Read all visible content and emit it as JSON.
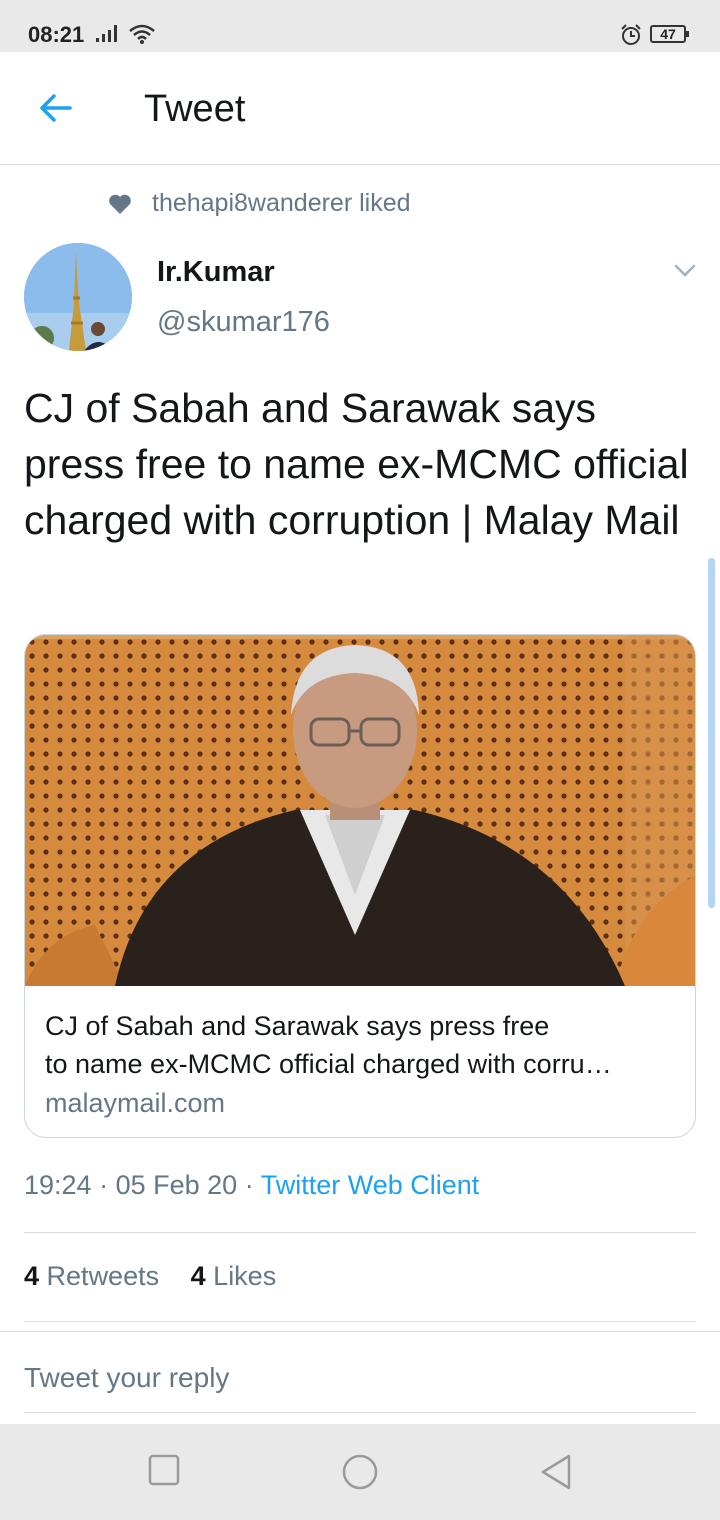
{
  "status": {
    "time": "08:21",
    "battery": "47"
  },
  "header": {
    "title": "Tweet"
  },
  "social_context": {
    "text": "thehapi8wanderer liked"
  },
  "author": {
    "name": "Ir.Kumar",
    "handle": "@skumar176"
  },
  "tweet": {
    "text": "CJ of Sabah and Sarawak says press free to name ex-MCMC official charged with corruption | Malay Mail"
  },
  "card": {
    "title_line1": "CJ of Sabah and Sarawak says press free",
    "title_line2": "to name ex-MCMC official charged with corru…",
    "domain": "malaymail.com"
  },
  "meta": {
    "time": "19:24",
    "separator": "·",
    "date": "05 Feb 20",
    "source": "Twitter Web Client"
  },
  "stats": {
    "retweets_count": "4",
    "retweets_label": "Retweets",
    "likes_count": "4",
    "likes_label": "Likes"
  },
  "reply": {
    "placeholder": "Tweet your reply"
  },
  "colors": {
    "accent": "#1da1f2",
    "secondary_text": "#657786"
  }
}
